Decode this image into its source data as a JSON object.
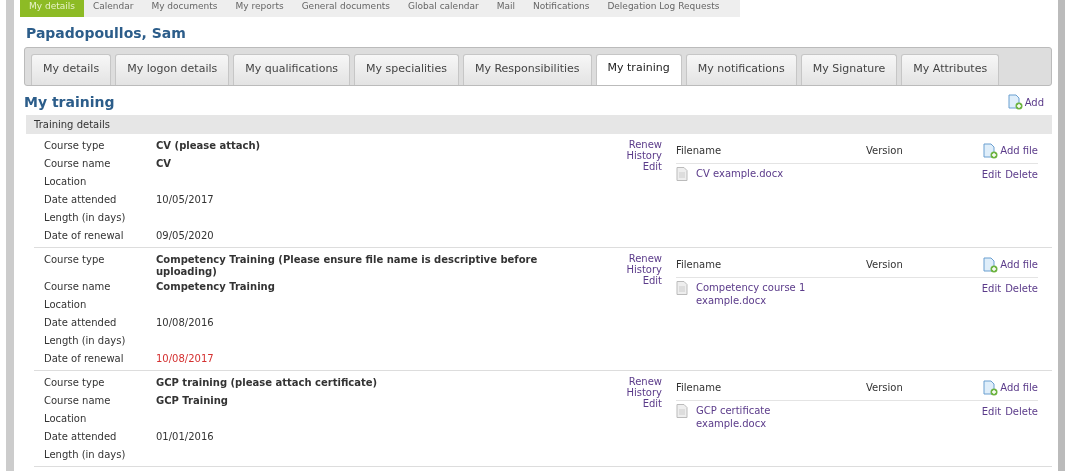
{
  "top_nav": [
    {
      "label": "My details",
      "selected": true
    },
    {
      "label": "Calendar",
      "selected": false
    },
    {
      "label": "My documents",
      "selected": false
    },
    {
      "label": "My reports",
      "selected": false
    },
    {
      "label": "General documents",
      "selected": false
    },
    {
      "label": "Global calendar",
      "selected": false
    },
    {
      "label": "Mail",
      "selected": false
    },
    {
      "label": "Notifications",
      "selected": false
    },
    {
      "label": "Delegation Log Requests",
      "selected": false
    }
  ],
  "person_name": "Papadopoullos, Sam",
  "tabs": [
    {
      "label": "My details",
      "selected": false
    },
    {
      "label": "My logon details",
      "selected": false
    },
    {
      "label": "My qualifications",
      "selected": false
    },
    {
      "label": "My specialities",
      "selected": false
    },
    {
      "label": "My Responsibilities",
      "selected": false
    },
    {
      "label": "My training",
      "selected": true
    },
    {
      "label": "My notifications",
      "selected": false
    },
    {
      "label": "My Signature",
      "selected": false
    },
    {
      "label": "My Attributes",
      "selected": false
    }
  ],
  "section_title": "My training",
  "add_label": "Add",
  "subheader": "Training details",
  "records": [
    {
      "renewal_overdue": false,
      "fields": [
        {
          "label": "Course type",
          "value": "CV (please attach)"
        },
        {
          "label": "Course name",
          "value": "CV"
        },
        {
          "label": "Location"
        },
        {
          "label": "Date attended",
          "value": "10/05/2017"
        },
        {
          "label": "Length (in days)"
        },
        {
          "label": "Date of renewal",
          "value": "09/05/2020"
        }
      ],
      "actions": [
        "Renew",
        "History",
        "Edit"
      ],
      "files_header": {
        "filename": "Filename",
        "version": "Version",
        "add": "Add file"
      },
      "files": [
        {
          "name": "CV example.docx",
          "actions": [
            "Edit",
            "Delete"
          ]
        }
      ]
    },
    {
      "renewal_overdue": true,
      "fields": [
        {
          "label": "Course type",
          "value": "Competency Training (Please ensure file name is descriptive before uploading)"
        },
        {
          "label": "Course name",
          "value": "Competency Training"
        },
        {
          "label": "Location"
        },
        {
          "label": "Date attended",
          "value": "10/08/2016"
        },
        {
          "label": "Length (in days)"
        },
        {
          "label": "Date of renewal",
          "value": "10/08/2017"
        }
      ],
      "actions": [
        "Renew",
        "History",
        "Edit"
      ],
      "files_header": {
        "filename": "Filename",
        "version": "Version",
        "add": "Add file"
      },
      "files": [
        {
          "name": "Competency course 1 example.docx",
          "actions": [
            "Edit",
            "Delete"
          ]
        }
      ]
    },
    {
      "fields": [
        {
          "label": "Course type",
          "value": "GCP training (please attach certificate)"
        },
        {
          "label": "Course name",
          "value": "GCP Training"
        },
        {
          "label": "Location"
        },
        {
          "label": "Date attended",
          "value": "01/01/2016"
        },
        {
          "label": "Length (in days)"
        }
      ],
      "actions": [
        "Renew",
        "History",
        "Edit"
      ],
      "files_header": {
        "filename": "Filename",
        "version": "Version",
        "add": "Add file"
      },
      "files": [
        {
          "name": "GCP certificate example.docx",
          "actions": [
            "Edit",
            "Delete"
          ]
        }
      ]
    }
  ]
}
